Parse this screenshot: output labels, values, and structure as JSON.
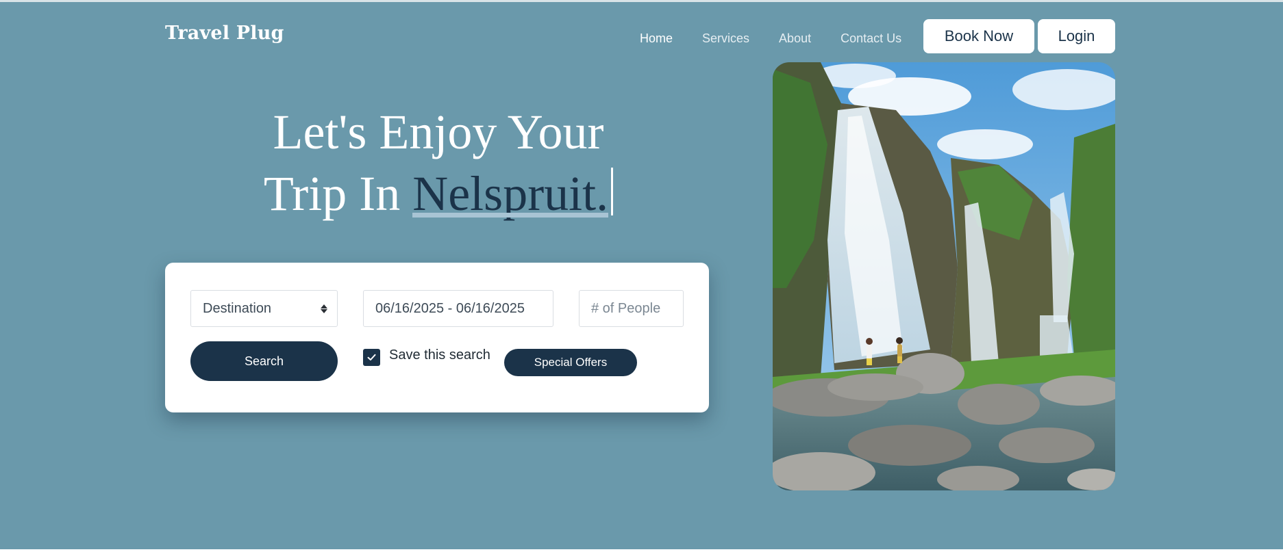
{
  "brand": "Travel Plug",
  "nav": {
    "items": [
      "Home",
      "Services",
      "About",
      "Contact Us"
    ],
    "book_label": "Book Now",
    "login_label": "Login"
  },
  "hero": {
    "line1": "Let's Enjoy Your",
    "line2_prefix": "Trip In ",
    "highlight": "Nelspruit."
  },
  "search": {
    "destination": "Destination",
    "dates": "06/16/2025 - 06/16/2025",
    "people_placeholder": "# of People",
    "search_label": "Search",
    "save_label": "Save this search",
    "save_checked": true,
    "offers_label": "Special Offers"
  },
  "image": {
    "subject": "waterfall-with-couple-on-rocks"
  },
  "colors": {
    "background": "#6a99ab",
    "navy": "#1b3349",
    "card": "#ffffff"
  }
}
